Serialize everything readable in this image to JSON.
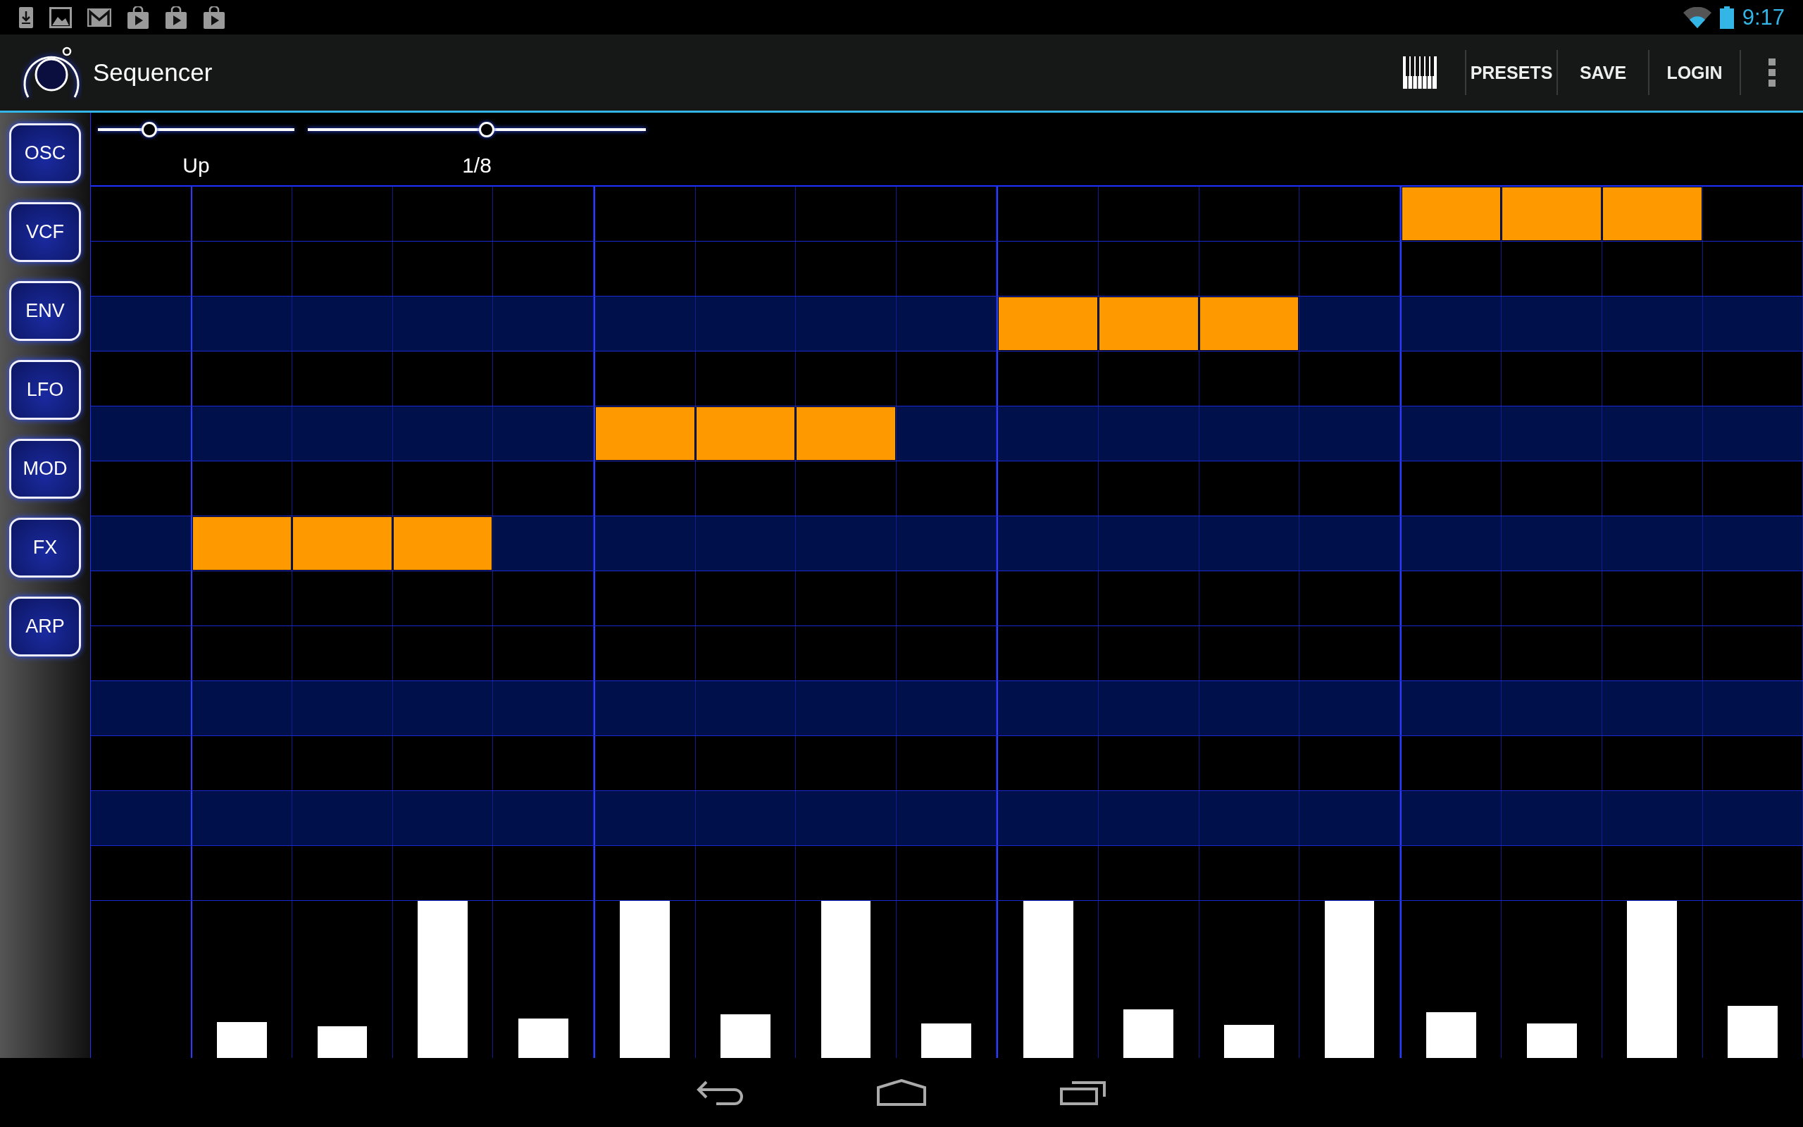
{
  "status_bar": {
    "time": "9:17"
  },
  "action_bar": {
    "title": "Sequencer",
    "actions": [
      "PRESETS",
      "SAVE",
      "LOGIN"
    ]
  },
  "sidebar": {
    "items": [
      "OSC",
      "VCF",
      "ENV",
      "LFO",
      "MOD",
      "FX",
      "ARP"
    ]
  },
  "sliders": [
    {
      "label": "Up",
      "level": 0.26
    },
    {
      "label": "1/8",
      "level": 0.53
    }
  ],
  "grid": {
    "rows": [
      {
        "kind": "white",
        "on": [
          false,
          false,
          false,
          false,
          false,
          false,
          false,
          false,
          false,
          false,
          false,
          false,
          true,
          true,
          true,
          false
        ]
      },
      {
        "kind": "white",
        "on": [
          false,
          false,
          false,
          false,
          false,
          false,
          false,
          false,
          false,
          false,
          false,
          false,
          false,
          false,
          false,
          false
        ]
      },
      {
        "kind": "black",
        "on": [
          false,
          false,
          false,
          false,
          false,
          false,
          false,
          false,
          true,
          true,
          true,
          false,
          false,
          false,
          false,
          false
        ]
      },
      {
        "kind": "white",
        "on": [
          false,
          false,
          false,
          false,
          false,
          false,
          false,
          false,
          false,
          false,
          false,
          false,
          false,
          false,
          false,
          false
        ]
      },
      {
        "kind": "black",
        "on": [
          false,
          false,
          false,
          false,
          true,
          true,
          true,
          false,
          false,
          false,
          false,
          false,
          false,
          false,
          false,
          false
        ]
      },
      {
        "kind": "white",
        "on": [
          false,
          false,
          false,
          false,
          false,
          false,
          false,
          false,
          false,
          false,
          false,
          false,
          false,
          false,
          false,
          false
        ]
      },
      {
        "kind": "black",
        "on": [
          true,
          true,
          true,
          false,
          false,
          false,
          false,
          false,
          false,
          false,
          false,
          false,
          false,
          false,
          false,
          false
        ]
      },
      {
        "kind": "white",
        "on": [
          false,
          false,
          false,
          false,
          false,
          false,
          false,
          false,
          false,
          false,
          false,
          false,
          false,
          false,
          false,
          false
        ]
      },
      {
        "kind": "white",
        "on": [
          false,
          false,
          false,
          false,
          false,
          false,
          false,
          false,
          false,
          false,
          false,
          false,
          false,
          false,
          false,
          false
        ]
      },
      {
        "kind": "black",
        "on": [
          false,
          false,
          false,
          false,
          false,
          false,
          false,
          false,
          false,
          false,
          false,
          false,
          false,
          false,
          false,
          false
        ]
      },
      {
        "kind": "white",
        "on": [
          false,
          false,
          false,
          false,
          false,
          false,
          false,
          false,
          false,
          false,
          false,
          false,
          false,
          false,
          false,
          false
        ]
      },
      {
        "kind": "black",
        "on": [
          false,
          false,
          false,
          false,
          false,
          false,
          false,
          false,
          false,
          false,
          false,
          false,
          false,
          false,
          false,
          false
        ]
      },
      {
        "kind": "white",
        "on": [
          false,
          false,
          false,
          false,
          false,
          false,
          false,
          false,
          false,
          false,
          false,
          false,
          false,
          false,
          false,
          false
        ]
      }
    ]
  },
  "velocity": [
    {
      "level": 0.23
    },
    {
      "level": 0.2
    },
    {
      "level": 1
    },
    {
      "level": 0.25
    },
    {
      "level": 1
    },
    {
      "level": 0.28
    },
    {
      "level": 1
    },
    {
      "level": 0.22
    },
    {
      "level": 1
    },
    {
      "level": 0.31
    },
    {
      "level": 0.21
    },
    {
      "level": 1
    },
    {
      "level": 0.29
    },
    {
      "level": 0.22
    },
    {
      "level": 1
    },
    {
      "level": 0.33
    }
  ]
}
